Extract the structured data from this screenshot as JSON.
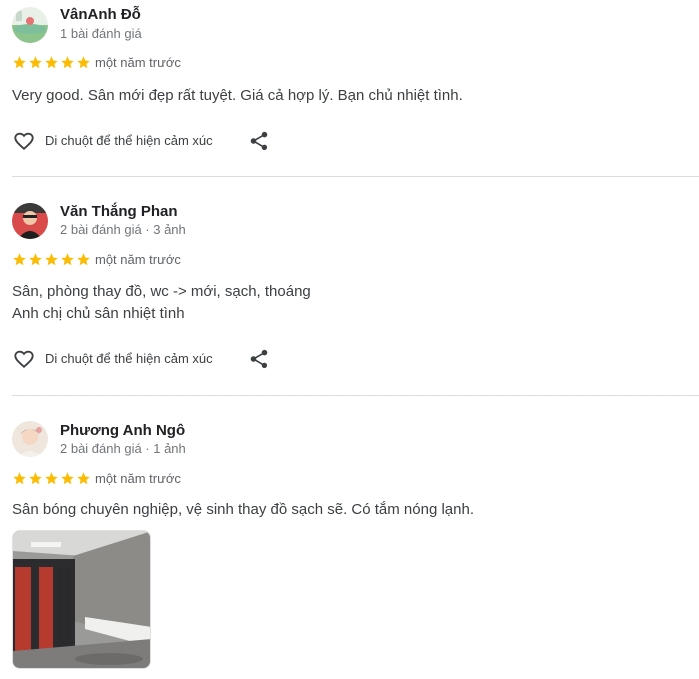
{
  "reviews": [
    {
      "name": "VânAnh Đỗ",
      "meta": "1 bài đánh giá",
      "rating": 5,
      "when": "một năm trước",
      "text": [
        "Very good. Sân mới đẹp rất tuyệt. Giá cả hợp lý. Bạn chủ nhiệt tình."
      ],
      "react_label": "Di chuột để thể hiện cảm xúc"
    },
    {
      "name": "Văn Thắng Phan",
      "meta": "2 bài đánh giá · 3 ảnh",
      "rating": 5,
      "when": "một năm trước",
      "text": [
        "Sân, phòng thay đồ, wc -> mới, sạch, thoáng",
        "Anh chị chủ sân nhiệt tình"
      ],
      "react_label": "Di chuột để thể hiện cảm xúc"
    },
    {
      "name": "Phương Anh Ngô",
      "meta": "2 bài đánh giá · 1 ảnh",
      "rating": 5,
      "when": "một năm trước",
      "text": [
        "Sân bóng chuyên nghiệp, vệ sinh thay đồ sạch sẽ. Có tắm nóng lạnh."
      ],
      "photos": 1
    }
  ],
  "colors": {
    "star": "#fbbc04",
    "text": "#3c4043",
    "meta": "#70757a",
    "divider": "#dadce0"
  },
  "icons": {
    "reaction": "heart-outline-icon",
    "share": "share-icon",
    "rating": "star-icon"
  }
}
